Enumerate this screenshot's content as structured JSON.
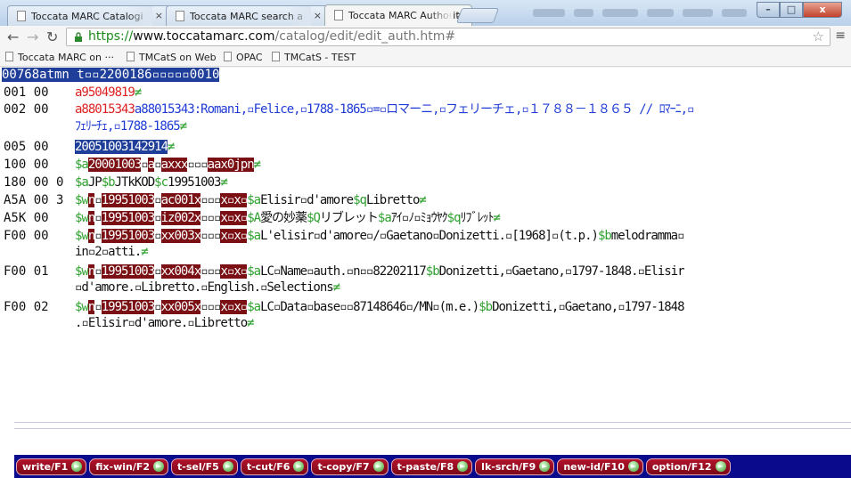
{
  "browser": {
    "tabs": [
      {
        "label": "Toccata MARC Catalogi"
      },
      {
        "label": "Toccata MARC search a"
      },
      {
        "label": "Toccata MARC Authoriti"
      }
    ],
    "close_glyph": "×",
    "url": {
      "scheme": "https://",
      "host": "www.toccatamarc.com",
      "path": "/catalog/edit/edit_auth.htm#"
    },
    "bookmarks": [
      {
        "label": "Toccata MARC on ···"
      },
      {
        "label": "TMCatS on Web"
      },
      {
        "label": "OPAC"
      },
      {
        "label": "TMCatS - TEST"
      }
    ]
  },
  "record": {
    "leader": {
      "a": "00768atmn",
      "b": " t▫▫2200186▫▫▫▫▫0010"
    },
    "f001": {
      "tag": "001 00",
      "value": "a95049819",
      "end": "≠"
    },
    "f002": {
      "tag": "002 00",
      "line1": "a88015343:Romani,▫Felice,▫1788-1865▫=▫ロマーニ,▫フェリーチェ,▫１７８８－１８６５ // ﾛﾏｰﾆ,▫",
      "line2": "ﾌｪﾘｰﾁｪ,▫1788-1865",
      "end": "≠"
    },
    "f005": {
      "tag": "005 00",
      "value": "20051003142914",
      "end": "≠"
    },
    "f100": {
      "tag": "100 00",
      "p1": "$a",
      "h1": "20001003",
      "h2": "a",
      "h3": "axxx",
      "p2": "▫▫▫",
      "h4": "aax0jpn",
      "end": "≠"
    },
    "f180": {
      "tag": "180 00  0",
      "s1": "$a",
      "t1": "JP",
      "s2": "$b",
      "t2": "JTkKOD",
      "s3": "$c",
      "t3": "19951003",
      "end": "≠"
    },
    "fA5A": {
      "tag": "A5A 00 3",
      "s1": "$w",
      "h1": "n",
      "h2": "19951003",
      "h3": "ac001x",
      "p1": "▫▫▫",
      "h4": "x▫x▫",
      "s2": "$a",
      "t1": "Elisir▫d'amore",
      "s3": "$q",
      "t2": "Libretto",
      "end": "≠"
    },
    "fA5K": {
      "tag": "A5K 00",
      "s1": "$w",
      "h1": "n",
      "h2": "19951003",
      "h3": "iz002x",
      "p1": "▫▫▫",
      "h4": "x▫x▫",
      "s2": "$A",
      "t1": "愛の妙薬",
      "s3": "$Q",
      "t2": "リブレット",
      "s4": "$a",
      "t3": "ｱｲ▫ﾉ▫ﾐｮｳﾔｸ",
      "s5": "$q",
      "t4": "ﾘﾌﾞﾚｯﾄ",
      "end": "≠"
    },
    "fF00a": {
      "tag": "F00 00",
      "s1": "$w",
      "h1": "n",
      "h2": "19951003",
      "h3": "xx003x",
      "p1": "▫▫▫",
      "h4": "x▫x▫",
      "s2": "$a",
      "t1": "L'elisir▫d'amore▫/▫Gaetano▫Donizetti.▫[1968]▫(t.p.)",
      "s3": "$b",
      "t2": "melodramma▫",
      "line2": "in▫2▫atti.",
      "end": "≠"
    },
    "fF00b": {
      "tag": "F00 01",
      "s1": "$w",
      "h1": "n",
      "h2": "19951003",
      "h3": "xx004x",
      "p1": "▫▫▫",
      "h4": "x▫x▫",
      "s2": "$a",
      "t1": "LC▫Name▫auth.▫n▫▫82202117",
      "s3": "$b",
      "t2": "Donizetti,▫Gaetano,▫1797-1848.▫Elisir",
      "line2": "▫d'amore.▫Libretto.▫English.▫Selections",
      "end": "≠"
    },
    "fF00c": {
      "tag": "F00 02",
      "s1": "$w",
      "h1": "n",
      "h2": "19951003",
      "h3": "xx005x",
      "p1": "▫▫▫",
      "h4": "x▫x▫",
      "s2": "$a",
      "t1": "LC▫Data▫base▫▫87148646▫/MN▫(m.e.)",
      "s3": "$b",
      "t2": "Donizetti,▫Gaetano,▫1797-1848",
      "line2": ".▫Elisir▫d'amore.▫Libretto",
      "end": "≠"
    }
  },
  "fkeys": [
    {
      "label": "write/F1"
    },
    {
      "label": "fix-win/F2"
    },
    {
      "label": "t-sel/F5"
    },
    {
      "label": "t-cut/F6"
    },
    {
      "label": "t-copy/F7"
    },
    {
      "label": "t-paste/F8"
    },
    {
      "label": "lk-srch/F9"
    },
    {
      "label": "new-id/F10"
    },
    {
      "label": "option/F12"
    }
  ],
  "colors": {
    "highlight_blue": "#1f3e99",
    "highlight_red": "#7a0f14",
    "subfield_green": "#2ea12e",
    "fkey_bar": "#0a0a8c"
  },
  "icons": [
    "back-icon",
    "forward-icon",
    "reload-icon",
    "lock-icon",
    "star-icon",
    "menu-icon",
    "page-icon",
    "arrow-icon"
  ]
}
